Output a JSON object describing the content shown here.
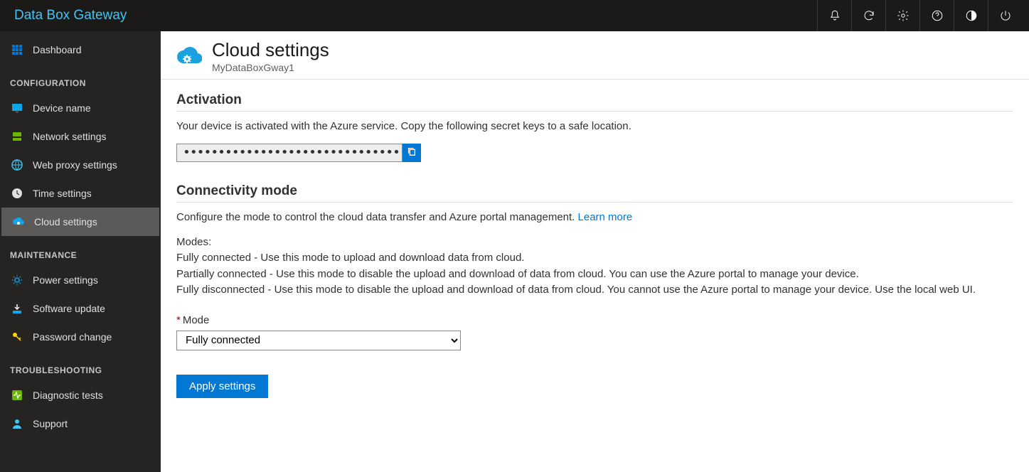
{
  "brand": "Data Box Gateway",
  "topIcons": [
    "bell",
    "refresh",
    "gear",
    "help",
    "contrast",
    "power"
  ],
  "sidebar": {
    "dashboard": "Dashboard",
    "groups": [
      {
        "heading": "CONFIGURATION",
        "items": [
          {
            "key": "device-name",
            "label": "Device name"
          },
          {
            "key": "network-settings",
            "label": "Network settings"
          },
          {
            "key": "web-proxy-settings",
            "label": "Web proxy settings"
          },
          {
            "key": "time-settings",
            "label": "Time settings"
          },
          {
            "key": "cloud-settings",
            "label": "Cloud settings",
            "active": true
          }
        ]
      },
      {
        "heading": "MAINTENANCE",
        "items": [
          {
            "key": "power-settings",
            "label": "Power settings"
          },
          {
            "key": "software-update",
            "label": "Software update"
          },
          {
            "key": "password-change",
            "label": "Password change"
          }
        ]
      },
      {
        "heading": "TROUBLESHOOTING",
        "items": [
          {
            "key": "diagnostic-tests",
            "label": "Diagnostic tests"
          },
          {
            "key": "support",
            "label": "Support"
          }
        ]
      }
    ]
  },
  "page": {
    "title": "Cloud settings",
    "subtitle": "MyDataBoxGway1"
  },
  "activation": {
    "heading": "Activation",
    "description": "Your device is activated with the Azure service. Copy the following secret keys to a safe location.",
    "secretMask": "••••••••••••••••••••••••••••••••••••••••••••••••••••••••••"
  },
  "connectivity": {
    "heading": "Connectivity mode",
    "description": "Configure the mode to control the cloud data transfer and Azure portal management. ",
    "learnMore": "Learn more",
    "modesLabel": "Modes:",
    "mode1": "Fully connected - Use this mode to upload and download data from cloud.",
    "mode2": "Partially connected - Use this mode to disable the upload and download of data from cloud. You can use the Azure portal to manage your device.",
    "mode3": "Fully disconnected - Use this mode to disable the upload and download of data from cloud. You cannot use the Azure portal to manage your device. Use the local web UI.",
    "fieldLabel": "Mode",
    "selected": "Fully connected",
    "options": [
      "Fully connected",
      "Partially connected",
      "Fully disconnected"
    ],
    "applyLabel": "Apply settings"
  }
}
